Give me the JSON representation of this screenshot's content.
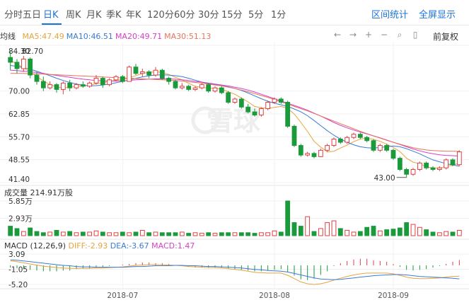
{
  "tabs": {
    "items": [
      "分时",
      "五日",
      "日K",
      "周K",
      "月K",
      "季K",
      "年K",
      "120分",
      "60分",
      "30分",
      "15分",
      "5分",
      "1分"
    ],
    "active": "日K",
    "right": [
      "区间统计",
      "全屏显示"
    ]
  },
  "ma": {
    "label": "均线",
    "items": [
      {
        "label": "MA5:47.49",
        "color": "#e8a33d"
      },
      {
        "label": "MA10:46.51",
        "color": "#3a7bd5"
      },
      {
        "label": "MA20:49.71",
        "color": "#d63fc7"
      },
      {
        "label": "MA30:51.13",
        "color": "#e8745a"
      }
    ]
  },
  "toolbar": {
    "icons": [
      "move-left-icon",
      "move-right-icon",
      "zoom-in-icon",
      "zoom-out-icon",
      "search-icon",
      "lock-icon"
    ],
    "adjust_label": "前复权"
  },
  "watermark": "雪球",
  "price": {
    "y_ticks": [
      "84.30",
      "82.70",
      "70.00",
      "62.85",
      "55.70",
      "48.55",
      "41.40"
    ],
    "low_label": "43.00"
  },
  "volume": {
    "title": "成交量 214.91万股",
    "y_ticks": [
      "5.85万",
      "2.93万"
    ]
  },
  "macd": {
    "label": "MACD (12,26,9)",
    "diff": "DIFF:-2.93",
    "dea": "DEA:-3.67",
    "macd": "MACD:1.47",
    "diff_color": "#e8a33d",
    "dea_color": "#3a7bd5",
    "macd_color": "#d63fc7",
    "y_ticks": [
      "3.09",
      "-1.05",
      "-5.20"
    ]
  },
  "x_axis": [
    "2018-07",
    "2018-08",
    "2018-09"
  ],
  "colors": {
    "up": "#e04040",
    "down": "#1a9a3a",
    "accent": "#1a73d9"
  },
  "chart_data": [
    {
      "type": "candlestick",
      "ylim": [
        41.4,
        84.3
      ],
      "y_ticks": [
        84.3,
        70.0,
        62.85,
        55.7,
        48.55,
        41.4
      ],
      "x_labels": [
        "2018-07",
        "2018-08",
        "2018-09"
      ],
      "candles": [
        [
          80.5,
          79.0,
          82.7,
          76.5
        ],
        [
          79.0,
          77.0,
          80.0,
          75.5
        ],
        [
          77.0,
          80.0,
          81.0,
          76.0
        ],
        [
          80.0,
          75.0,
          80.5,
          74.0
        ],
        [
          75.0,
          73.0,
          76.0,
          72.0
        ],
        [
          73.0,
          71.0,
          74.5,
          70.0
        ],
        [
          71.0,
          72.0,
          73.0,
          70.5
        ],
        [
          72.0,
          70.5,
          72.5,
          69.5
        ],
        [
          70.5,
          72.5,
          73.0,
          69.0
        ],
        [
          72.5,
          71.0,
          73.5,
          70.0
        ],
        [
          71.0,
          72.0,
          72.5,
          70.5
        ],
        [
          72.0,
          71.5,
          73.0,
          71.0
        ],
        [
          71.5,
          72.5,
          73.0,
          71.0
        ],
        [
          72.5,
          74.0,
          75.0,
          72.0
        ],
        [
          74.0,
          72.0,
          74.5,
          71.0
        ],
        [
          72.0,
          73.5,
          74.0,
          71.5
        ],
        [
          73.5,
          74.5,
          75.0,
          73.0
        ],
        [
          74.5,
          73.0,
          75.0,
          72.5
        ],
        [
          73.0,
          77.5,
          78.0,
          73.0
        ],
        [
          77.5,
          75.5,
          78.5,
          75.0
        ],
        [
          75.5,
          76.0,
          77.0,
          74.5
        ],
        [
          76.0,
          75.0,
          76.5,
          74.0
        ],
        [
          75.0,
          76.5,
          77.5,
          74.5
        ],
        [
          76.5,
          74.0,
          77.0,
          73.5
        ],
        [
          74.0,
          73.0,
          74.5,
          72.0
        ],
        [
          73.0,
          71.0,
          73.5,
          70.5
        ],
        [
          71.0,
          71.5,
          72.5,
          70.5
        ],
        [
          71.5,
          70.5,
          72.0,
          70.0
        ],
        [
          70.5,
          71.0,
          71.5,
          70.0
        ],
        [
          71.0,
          72.0,
          72.5,
          70.5
        ],
        [
          72.0,
          70.0,
          72.5,
          69.5
        ],
        [
          70.0,
          71.0,
          71.5,
          69.5
        ],
        [
          71.0,
          69.5,
          71.5,
          69.0
        ],
        [
          69.5,
          66.5,
          70.0,
          66.0
        ],
        [
          66.5,
          67.5,
          68.0,
          66.0
        ],
        [
          67.5,
          65.0,
          68.0,
          64.5
        ],
        [
          65.0,
          63.5,
          66.0,
          63.0
        ],
        [
          63.5,
          62.5,
          64.5,
          62.0
        ],
        [
          62.5,
          64.5,
          65.0,
          62.0
        ],
        [
          64.5,
          66.5,
          67.0,
          64.0
        ],
        [
          66.5,
          67.5,
          68.0,
          66.0
        ],
        [
          67.5,
          66.5,
          68.0,
          66.0
        ],
        [
          66.5,
          59.0,
          67.0,
          58.5
        ],
        [
          59.0,
          53.0,
          59.5,
          52.5
        ],
        [
          53.0,
          50.0,
          53.5,
          49.5
        ],
        [
          50.0,
          50.5,
          51.0,
          49.5
        ],
        [
          50.5,
          49.5,
          51.0,
          49.0
        ],
        [
          49.5,
          51.5,
          52.0,
          49.5
        ],
        [
          51.5,
          53.0,
          53.5,
          51.0
        ],
        [
          53.0,
          55.0,
          55.5,
          52.5
        ],
        [
          55.0,
          54.0,
          55.5,
          53.5
        ],
        [
          54.0,
          55.5,
          56.0,
          53.5
        ],
        [
          55.5,
          56.5,
          57.0,
          55.0
        ],
        [
          56.5,
          55.5,
          57.0,
          55.0
        ],
        [
          55.5,
          54.5,
          56.0,
          54.0
        ],
        [
          54.5,
          51.5,
          55.0,
          51.0
        ],
        [
          51.5,
          53.0,
          53.5,
          51.0
        ],
        [
          53.0,
          51.5,
          53.5,
          51.0
        ],
        [
          51.5,
          49.0,
          52.0,
          48.5
        ],
        [
          49.0,
          45.5,
          49.5,
          45.0
        ],
        [
          45.5,
          44.0,
          46.0,
          43.0
        ],
        [
          44.0,
          45.5,
          46.0,
          43.5
        ],
        [
          45.5,
          47.5,
          48.0,
          45.0
        ],
        [
          47.5,
          46.0,
          48.0,
          45.5
        ],
        [
          46.0,
          45.5,
          46.5,
          45.0
        ],
        [
          45.5,
          46.0,
          46.5,
          45.0
        ],
        [
          46.0,
          48.5,
          49.0,
          45.5
        ],
        [
          48.5,
          47.0,
          49.0,
          46.5
        ],
        [
          47.0,
          51.0,
          51.5,
          46.5
        ]
      ],
      "ma5": [
        79.5,
        78.5,
        77.2,
        76.0,
        74.5,
        73.2,
        72.0,
        71.3,
        71.0,
        71.2,
        71.5,
        71.6,
        71.8,
        72.3,
        72.6,
        73.0,
        73.4,
        73.6,
        74.2,
        74.8,
        75.5,
        75.8,
        76.0,
        75.8,
        75.2,
        74.3,
        73.5,
        72.4,
        71.5,
        71.1,
        71.0,
        70.8,
        70.6,
        69.8,
        69.0,
        67.8,
        66.6,
        65.2,
        64.8,
        64.6,
        64.9,
        65.2,
        64.6,
        62.8,
        60.2,
        57.4,
        54.3,
        52.5,
        51.0,
        51.2,
        52.2,
        53.1,
        54.2,
        55.0,
        55.3,
        54.9,
        54.3,
        53.4,
        52.4,
        51.1,
        49.0,
        47.8,
        47.3,
        46.3,
        46.0,
        45.9,
        46.5,
        46.8,
        47.5
      ],
      "ma10": [
        78.0,
        77.7,
        77.3,
        76.8,
        76.2,
        75.5,
        74.8,
        74.0,
        73.3,
        72.7,
        72.2,
        71.8,
        71.6,
        71.7,
        71.9,
        72.2,
        72.6,
        73.0,
        73.5,
        74.0,
        74.4,
        74.8,
        75.0,
        75.1,
        75.0,
        74.8,
        74.5,
        74.0,
        73.4,
        72.8,
        72.3,
        72.0,
        71.7,
        71.3,
        70.8,
        70.2,
        69.4,
        68.5,
        67.6,
        66.8,
        66.2,
        65.7,
        65.2,
        64.4,
        63.5,
        62.3,
        60.8,
        59.2,
        57.6,
        56.2,
        55.0,
        54.0,
        53.2,
        52.6,
        52.3,
        52.2,
        52.4,
        52.6,
        52.8,
        52.6,
        52.0,
        51.2,
        50.4,
        49.4,
        48.5,
        47.9,
        47.3,
        46.9,
        46.5
      ],
      "ma20": [
        76.5,
        76.4,
        76.2,
        76.0,
        75.8,
        75.5,
        75.2,
        74.9,
        74.6,
        74.3,
        74.0,
        73.7,
        73.5,
        73.3,
        73.2,
        73.1,
        73.1,
        73.2,
        73.3,
        73.5,
        73.6,
        73.7,
        73.8,
        73.8,
        73.8,
        73.7,
        73.5,
        73.3,
        73.0,
        72.8,
        72.5,
        72.2,
        71.9,
        71.6,
        71.2,
        70.8,
        70.3,
        69.7,
        69.0,
        68.3,
        67.6,
        66.9,
        66.2,
        65.5,
        64.8,
        64.0,
        63.1,
        62.2,
        61.2,
        60.2,
        59.3,
        58.5,
        57.8,
        57.2,
        56.6,
        56.0,
        55.4,
        54.7,
        54.0,
        53.3,
        52.6,
        51.9,
        51.3,
        50.8,
        50.4,
        50.1,
        49.9,
        49.8,
        49.7
      ],
      "ma30": [
        75.5,
        75.5,
        75.5,
        75.4,
        75.4,
        75.3,
        75.2,
        75.1,
        75.0,
        74.9,
        74.8,
        74.7,
        74.6,
        74.5,
        74.4,
        74.3,
        74.2,
        74.1,
        74.0,
        73.9,
        73.8,
        73.7,
        73.6,
        73.5,
        73.4,
        73.3,
        73.1,
        72.9,
        72.7,
        72.5,
        72.2,
        71.9,
        71.6,
        71.2,
        70.8,
        70.3,
        69.8,
        69.2,
        68.6,
        68.0,
        67.3,
        66.6,
        65.9,
        65.2,
        64.5,
        63.8,
        63.0,
        62.2,
        61.4,
        60.6,
        59.8,
        59.0,
        58.2,
        57.4,
        56.7,
        56.0,
        55.3,
        54.6,
        54.0,
        53.4,
        52.8,
        52.3,
        51.9,
        51.6,
        51.4,
        51.3,
        51.2,
        51.2,
        51.13
      ],
      "low_annotation": 43.0
    },
    {
      "type": "bar",
      "title": "成交量 214.91万股",
      "ylim": [
        0,
        5.85
      ],
      "y_ticks": [
        5.85,
        2.93
      ],
      "values": [
        1.6,
        1.2,
        0.7,
        1.3,
        0.7,
        0.5,
        0.6,
        0.9,
        0.6,
        0.7,
        0.5,
        0.6,
        0.6,
        0.8,
        0.6,
        0.5,
        0.5,
        0.6,
        0.5,
        0.6,
        0.9,
        0.5,
        0.6,
        0.5,
        0.5,
        0.5,
        0.6,
        0.4,
        0.5,
        0.4,
        0.5,
        0.4,
        0.5,
        0.5,
        0.5,
        0.5,
        0.5,
        0.4,
        0.5,
        0.5,
        0.8,
        0.6,
        5.85,
        2.2,
        1.6,
        3.2,
        0.7,
        1.2,
        2.2,
        2.5,
        1.2,
        0.9,
        0.6,
        0.7,
        1.4,
        1.6,
        0.8,
        1.0,
        1.1,
        1.3,
        2.2,
        1.9,
        1.4,
        1.0,
        0.6,
        0.5,
        0.7,
        0.6,
        0.9
      ]
    },
    {
      "type": "line",
      "title": "MACD (12,26,9)",
      "ylim": [
        -5.2,
        3.09
      ],
      "y_ticks": [
        3.09,
        -1.05,
        -5.2
      ],
      "series": [
        {
          "name": "DIFF",
          "values": [
            1.2,
            1.0,
            0.7,
            0.4,
            0.1,
            -0.2,
            -0.4,
            -0.6,
            -0.7,
            -0.8,
            -0.8,
            -0.8,
            -0.8,
            -0.7,
            -0.7,
            -0.6,
            -0.5,
            -0.4,
            -0.2,
            0.0,
            0.1,
            0.2,
            0.2,
            0.2,
            0.1,
            0.0,
            -0.1,
            -0.3,
            -0.4,
            -0.5,
            -0.6,
            -0.6,
            -0.7,
            -0.9,
            -1.1,
            -1.3,
            -1.6,
            -1.9,
            -2.0,
            -2.1,
            -2.1,
            -2.1,
            -2.7,
            -3.6,
            -4.5,
            -5.0,
            -5.2,
            -5.0,
            -4.6,
            -4.0,
            -3.5,
            -3.0,
            -2.6,
            -2.3,
            -2.1,
            -2.1,
            -2.1,
            -2.1,
            -2.3,
            -2.7,
            -3.2,
            -3.5,
            -3.6,
            -3.6,
            -3.5,
            -3.4,
            -3.2,
            -3.0,
            -2.93
          ]
        },
        {
          "name": "DEA",
          "values": [
            1.5,
            1.4,
            1.2,
            1.0,
            0.8,
            0.6,
            0.4,
            0.2,
            0.0,
            -0.1,
            -0.3,
            -0.4,
            -0.4,
            -0.5,
            -0.5,
            -0.5,
            -0.5,
            -0.5,
            -0.4,
            -0.3,
            -0.3,
            -0.2,
            -0.1,
            -0.1,
            -0.1,
            0.0,
            0.0,
            -0.1,
            -0.1,
            -0.2,
            -0.3,
            -0.3,
            -0.4,
            -0.5,
            -0.6,
            -0.7,
            -0.9,
            -1.1,
            -1.2,
            -1.4,
            -1.5,
            -1.6,
            -1.8,
            -2.2,
            -2.6,
            -3.0,
            -3.4,
            -3.7,
            -3.8,
            -3.9,
            -3.8,
            -3.6,
            -3.4,
            -3.2,
            -3.0,
            -2.8,
            -2.7,
            -2.6,
            -2.5,
            -2.5,
            -2.6,
            -2.8,
            -3.0,
            -3.1,
            -3.2,
            -3.3,
            -3.4,
            -3.5,
            -3.67
          ]
        },
        {
          "name": "MACD",
          "values": [
            -0.6,
            -0.8,
            -1.0,
            -1.2,
            -1.4,
            -1.6,
            -1.6,
            -1.6,
            -1.4,
            -1.4,
            -1.0,
            -0.8,
            -0.8,
            -0.4,
            -0.4,
            -0.2,
            0.0,
            0.2,
            0.4,
            0.6,
            0.8,
            0.8,
            0.6,
            0.6,
            0.4,
            0.0,
            -0.2,
            -0.4,
            -0.6,
            -0.6,
            -0.6,
            -0.6,
            -0.6,
            -0.8,
            -1.0,
            -1.2,
            -1.4,
            -1.6,
            -1.6,
            -1.4,
            -1.2,
            -1.0,
            -1.8,
            -2.8,
            -3.8,
            -4.0,
            -3.6,
            -2.6,
            -1.6,
            -0.2,
            0.6,
            1.2,
            1.6,
            1.8,
            1.8,
            1.4,
            1.2,
            1.0,
            0.4,
            -0.4,
            -1.2,
            -1.4,
            -1.2,
            -1.0,
            -0.6,
            -0.2,
            0.4,
            1.0,
            1.47
          ]
        }
      ]
    }
  ]
}
